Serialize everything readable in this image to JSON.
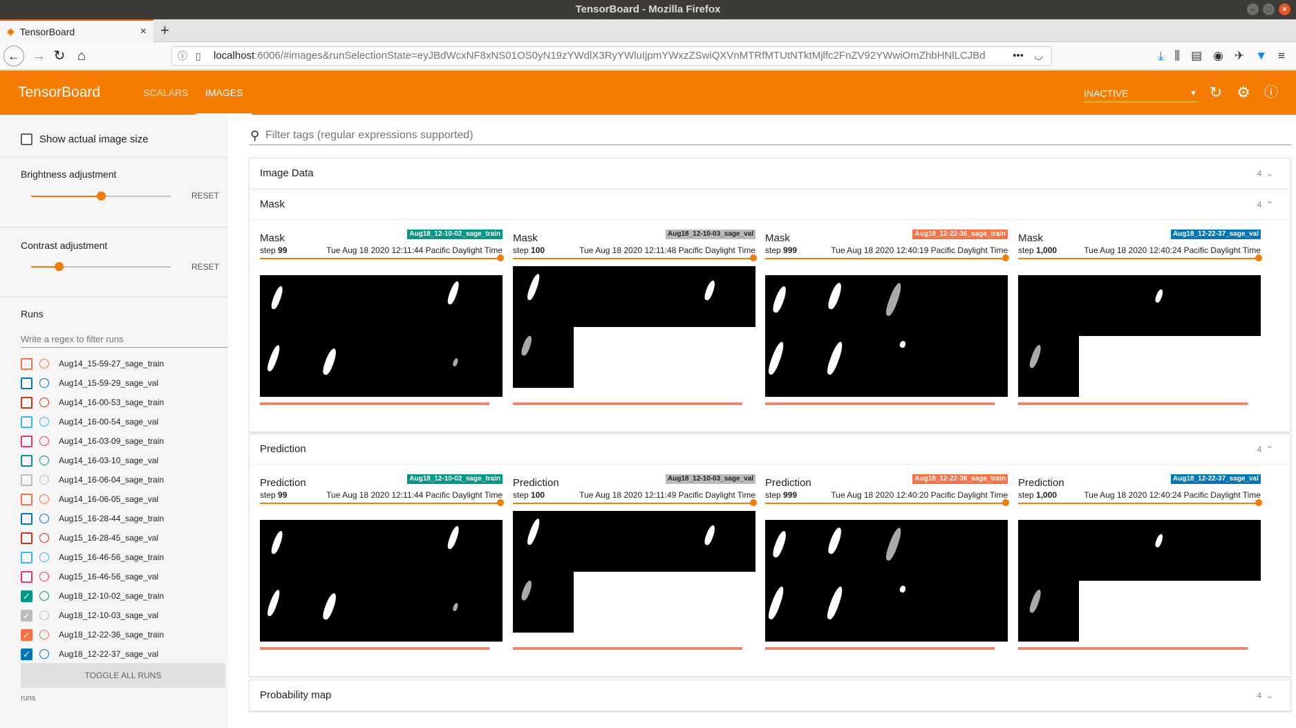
{
  "window": {
    "title": "TensorBoard - Mozilla Firefox"
  },
  "browser": {
    "tab_title": "TensorBoard",
    "url_host": "localhost",
    "url_rest": ":6006/#images&runSelectionState=eyJBdWcxNF8xNS01OS0yN19zYWdlX3RyYWluIjpmYWxzZSwiQXVnMTRfMTUtNTktMjlfc2FnZV92YWwiOmZhbHNlLCJBd",
    "url_more": "•••"
  },
  "tb": {
    "title": "TensorBoard",
    "tabs": [
      "SCALARS",
      "IMAGES"
    ],
    "status": "INACTIVE"
  },
  "sidebar": {
    "show_actual_size": "Show actual image size",
    "brightness": {
      "label": "Brightness adjustment",
      "reset": "RESET",
      "value": 0.5
    },
    "contrast": {
      "label": "Contrast adjustment",
      "reset": "RESET",
      "value": 0.2
    },
    "runs_title": "Runs",
    "runs_filter_placeholder": "Write a regex to filter runs",
    "toggle_all": "TOGGLE ALL RUNS",
    "footer": "runs",
    "runs": [
      {
        "name": "Aug14_15-59-27_sage_train",
        "color": "#ff7043",
        "checked": false
      },
      {
        "name": "Aug14_15-59-29_sage_val",
        "color": "#0077bb",
        "checked": false
      },
      {
        "name": "Aug14_16-00-53_sage_train",
        "color": "#cc3311",
        "checked": false
      },
      {
        "name": "Aug14_16-00-54_sage_val",
        "color": "#33bbee",
        "checked": false
      },
      {
        "name": "Aug14_16-03-09_sage_train",
        "color": "#ee3377",
        "checked": false
      },
      {
        "name": "Aug14_16-03-10_sage_val",
        "color": "#009988",
        "checked": false
      },
      {
        "name": "Aug14_16-06-04_sage_train",
        "color": "#bbbbbb",
        "checked": false
      },
      {
        "name": "Aug14_16-06-05_sage_val",
        "color": "#ff7043",
        "checked": false
      },
      {
        "name": "Aug15_16-28-44_sage_train",
        "color": "#0077bb",
        "checked": false
      },
      {
        "name": "Aug15_16-28-45_sage_val",
        "color": "#cc3311",
        "checked": false
      },
      {
        "name": "Aug15_16-46-56_sage_train",
        "color": "#33bbee",
        "checked": false
      },
      {
        "name": "Aug15_16-46-56_sage_val",
        "color": "#ee3377",
        "checked": false
      },
      {
        "name": "Aug18_12-10-02_sage_train",
        "color": "#009988",
        "checked": true
      },
      {
        "name": "Aug18_12-10-03_sage_val",
        "color": "#bbbbbb",
        "checked": true
      },
      {
        "name": "Aug18_12-22-36_sage_train",
        "color": "#ff7043",
        "checked": true
      },
      {
        "name": "Aug18_12-22-37_sage_val",
        "color": "#0077bb",
        "checked": true
      }
    ]
  },
  "main": {
    "filter_placeholder": "Filter tags (regular expressions supported)",
    "panes": [
      {
        "title": "Image Data",
        "count": "4",
        "expanded": false
      },
      {
        "title": "Mask",
        "count": "4",
        "expanded": true,
        "cards": [
          {
            "title": "Mask",
            "run": "Aug18_12-10-02_sage_train",
            "run_color": "#009988",
            "step_label": "step",
            "step": "99",
            "time": "Tue Aug 18 2020 12:11:44 Pacific Daylight Time"
          },
          {
            "title": "Mask",
            "run": "Aug18_12-10-03_sage_val",
            "run_color": "#bbbbbb",
            "step_label": "step",
            "step": "100",
            "time": "Tue Aug 18 2020 12:11:48 Pacific Daylight Time"
          },
          {
            "title": "Mask",
            "run": "Aug18_12-22-36_sage_train",
            "run_color": "#ff7043",
            "step_label": "step",
            "step": "999",
            "time": "Tue Aug 18 2020 12:40:19 Pacific Daylight Time"
          },
          {
            "title": "Mask",
            "run": "Aug18_12-22-37_sage_val",
            "run_color": "#0077bb",
            "step_label": "step",
            "step": "1,000",
            "time": "Tue Aug 18 2020 12:40:24 Pacific Daylight Time"
          }
        ]
      },
      {
        "title": "Prediction",
        "count": "4",
        "expanded": true,
        "cards": [
          {
            "title": "Prediction",
            "run": "Aug18_12-10-02_sage_train",
            "run_color": "#009988",
            "step_label": "step",
            "step": "99",
            "time": "Tue Aug 18 2020 12:11:44 Pacific Daylight Time"
          },
          {
            "title": "Prediction",
            "run": "Aug18_12-10-03_sage_val",
            "run_color": "#bbbbbb",
            "step_label": "step",
            "step": "100",
            "time": "Tue Aug 18 2020 12:11:49 Pacific Daylight Time"
          },
          {
            "title": "Prediction",
            "run": "Aug18_12-22-36_sage_train",
            "run_color": "#ff7043",
            "step_label": "step",
            "step": "999",
            "time": "Tue Aug 18 2020 12:40:20 Pacific Daylight Time"
          },
          {
            "title": "Prediction",
            "run": "Aug18_12-22-37_sage_val",
            "run_color": "#0077bb",
            "step_label": "step",
            "step": "1,000",
            "time": "Tue Aug 18 2020 12:40:24 Pacific Daylight Time"
          }
        ]
      },
      {
        "title": "Probability map",
        "count": "4",
        "expanded": false
      }
    ]
  }
}
